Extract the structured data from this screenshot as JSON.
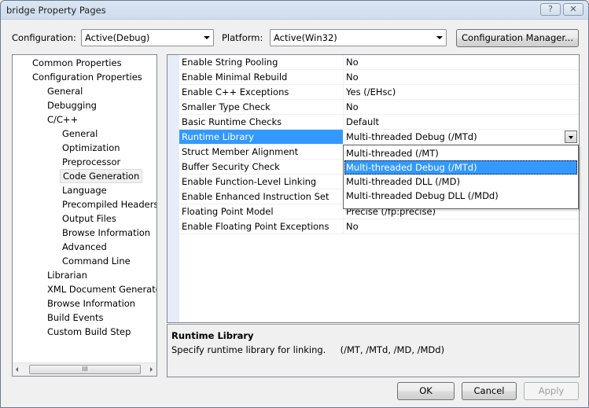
{
  "window": {
    "title": "bridge Property Pages",
    "help_label": "?",
    "close_label": "✕"
  },
  "toolbar": {
    "configuration_label": "Configuration:",
    "configuration_value": "Active(Debug)",
    "platform_label": "Platform:",
    "platform_value": "Active(Win32)",
    "config_manager_label": "Configuration Manager..."
  },
  "tree": {
    "items": [
      {
        "label": "Common Properties",
        "level": 0
      },
      {
        "label": "Configuration Properties",
        "level": 0
      },
      {
        "label": "General",
        "level": 1
      },
      {
        "label": "Debugging",
        "level": 1
      },
      {
        "label": "C/C++",
        "level": 1
      },
      {
        "label": "General",
        "level": 2
      },
      {
        "label": "Optimization",
        "level": 2
      },
      {
        "label": "Preprocessor",
        "level": 2
      },
      {
        "label": "Code Generation",
        "level": 2,
        "selected": true
      },
      {
        "label": "Language",
        "level": 2
      },
      {
        "label": "Precompiled Headers",
        "level": 2
      },
      {
        "label": "Output Files",
        "level": 2
      },
      {
        "label": "Browse Information",
        "level": 2
      },
      {
        "label": "Advanced",
        "level": 2
      },
      {
        "label": "Command Line",
        "level": 2
      },
      {
        "label": "Librarian",
        "level": 1
      },
      {
        "label": "XML Document Generator",
        "level": 1
      },
      {
        "label": "Browse Information",
        "level": 1
      },
      {
        "label": "Build Events",
        "level": 1
      },
      {
        "label": "Custom Build Step",
        "level": 1
      }
    ],
    "scroll_thumb_label": "III"
  },
  "grid": {
    "rows": [
      {
        "name": "Enable String Pooling",
        "value": "No"
      },
      {
        "name": "Enable Minimal Rebuild",
        "value": "No"
      },
      {
        "name": "Enable C++ Exceptions",
        "value": "Yes (/EHsc)"
      },
      {
        "name": "Smaller Type Check",
        "value": "No"
      },
      {
        "name": "Basic Runtime Checks",
        "value": "Default"
      },
      {
        "name": "Runtime Library",
        "value": "Multi-threaded Debug (/MTd)",
        "selected": true
      },
      {
        "name": "Struct Member Alignment",
        "value": ""
      },
      {
        "name": "Buffer Security Check",
        "value": ""
      },
      {
        "name": "Enable Function-Level Linking",
        "value": ""
      },
      {
        "name": "Enable Enhanced Instruction Set",
        "value": ""
      },
      {
        "name": "Floating Point Model",
        "value": "Precise (/fp:precise)"
      },
      {
        "name": "Enable Floating Point Exceptions",
        "value": "No"
      }
    ]
  },
  "dropdown": {
    "options": [
      {
        "label": "Multi-threaded (/MT)"
      },
      {
        "label": "Multi-threaded Debug (/MTd)",
        "selected": true
      },
      {
        "label": "Multi-threaded DLL (/MD)"
      },
      {
        "label": "Multi-threaded Debug DLL (/MDd)"
      }
    ]
  },
  "description": {
    "title": "Runtime Library",
    "text": "Specify runtime library for linking.     (/MT, /MTd, /MD, /MDd)"
  },
  "footer": {
    "ok_label": "OK",
    "cancel_label": "Cancel",
    "apply_label": "Apply"
  }
}
